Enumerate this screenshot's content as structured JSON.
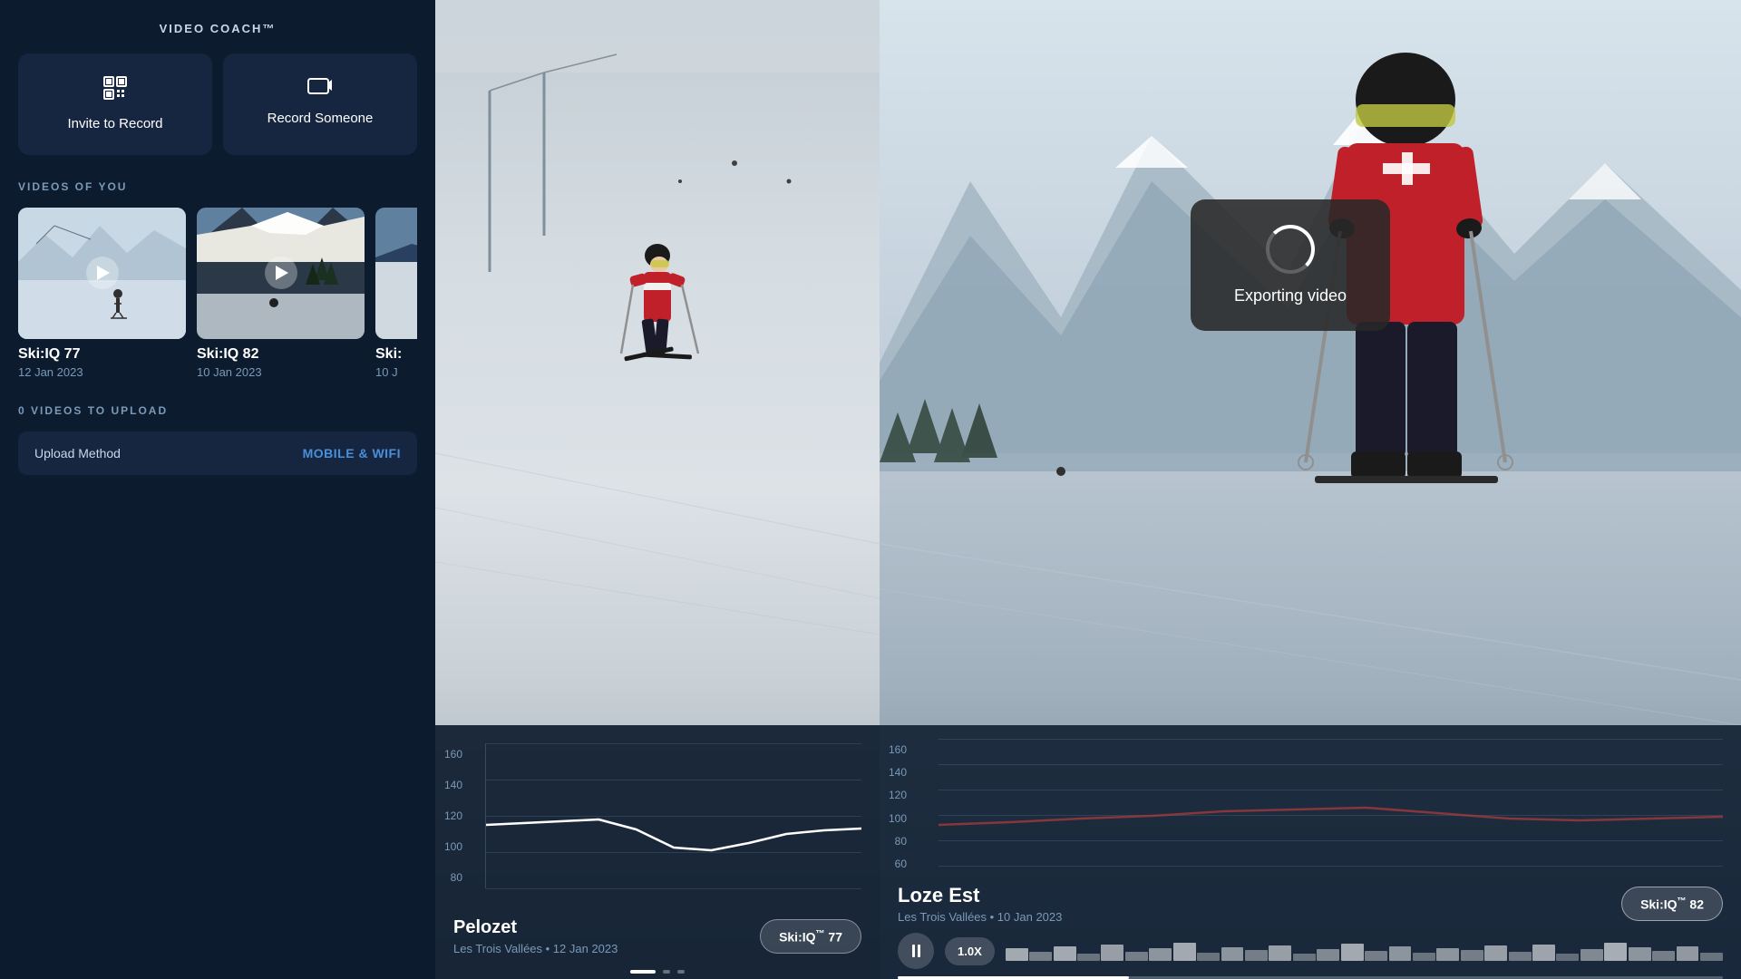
{
  "app": {
    "title": "VIDEO COACH™"
  },
  "left": {
    "action_buttons": [
      {
        "id": "invite",
        "icon": "📷",
        "label": "Invite to Record"
      },
      {
        "id": "record",
        "icon": "🎥",
        "label": "Record Someone"
      }
    ],
    "videos_section_title": "VIDEOS OF YOU",
    "videos": [
      {
        "id": "v1",
        "title": "Ski:IQ 77",
        "date": "12 Jan 2023"
      },
      {
        "id": "v2",
        "title": "Ski:IQ 82",
        "date": "10 Jan 2023"
      },
      {
        "id": "v3",
        "title": "Ski:",
        "date": "10 J"
      }
    ],
    "upload_section_title": "0 VIDEOS TO UPLOAD",
    "upload_method_label": "Upload Method",
    "upload_method_value": "MOBILE & WIFI"
  },
  "middle": {
    "chart": {
      "y_labels": [
        "160",
        "140",
        "120",
        "100",
        "80"
      ],
      "place": "Pelozet",
      "meta": "Les Trois Vallées  •  12 Jan 2023",
      "ski_iq_label": "Ski:IQ",
      "ski_iq_tm": "™",
      "ski_iq_value": "77",
      "controls": [
        "▶",
        "⏸",
        "⏩"
      ]
    }
  },
  "right": {
    "export_overlay": {
      "text": "Exporting video"
    },
    "chart": {
      "y_labels": [
        "160",
        "140",
        "120",
        "100",
        "80",
        "60"
      ],
      "place": "Loze Est",
      "meta": "Les Trois Vallées  •  10 Jan 2023",
      "ski_iq_label": "Ski:IQ",
      "ski_iq_tm": "™",
      "ski_iq_value": "82"
    },
    "playback": {
      "speed": "1.0X"
    }
  }
}
